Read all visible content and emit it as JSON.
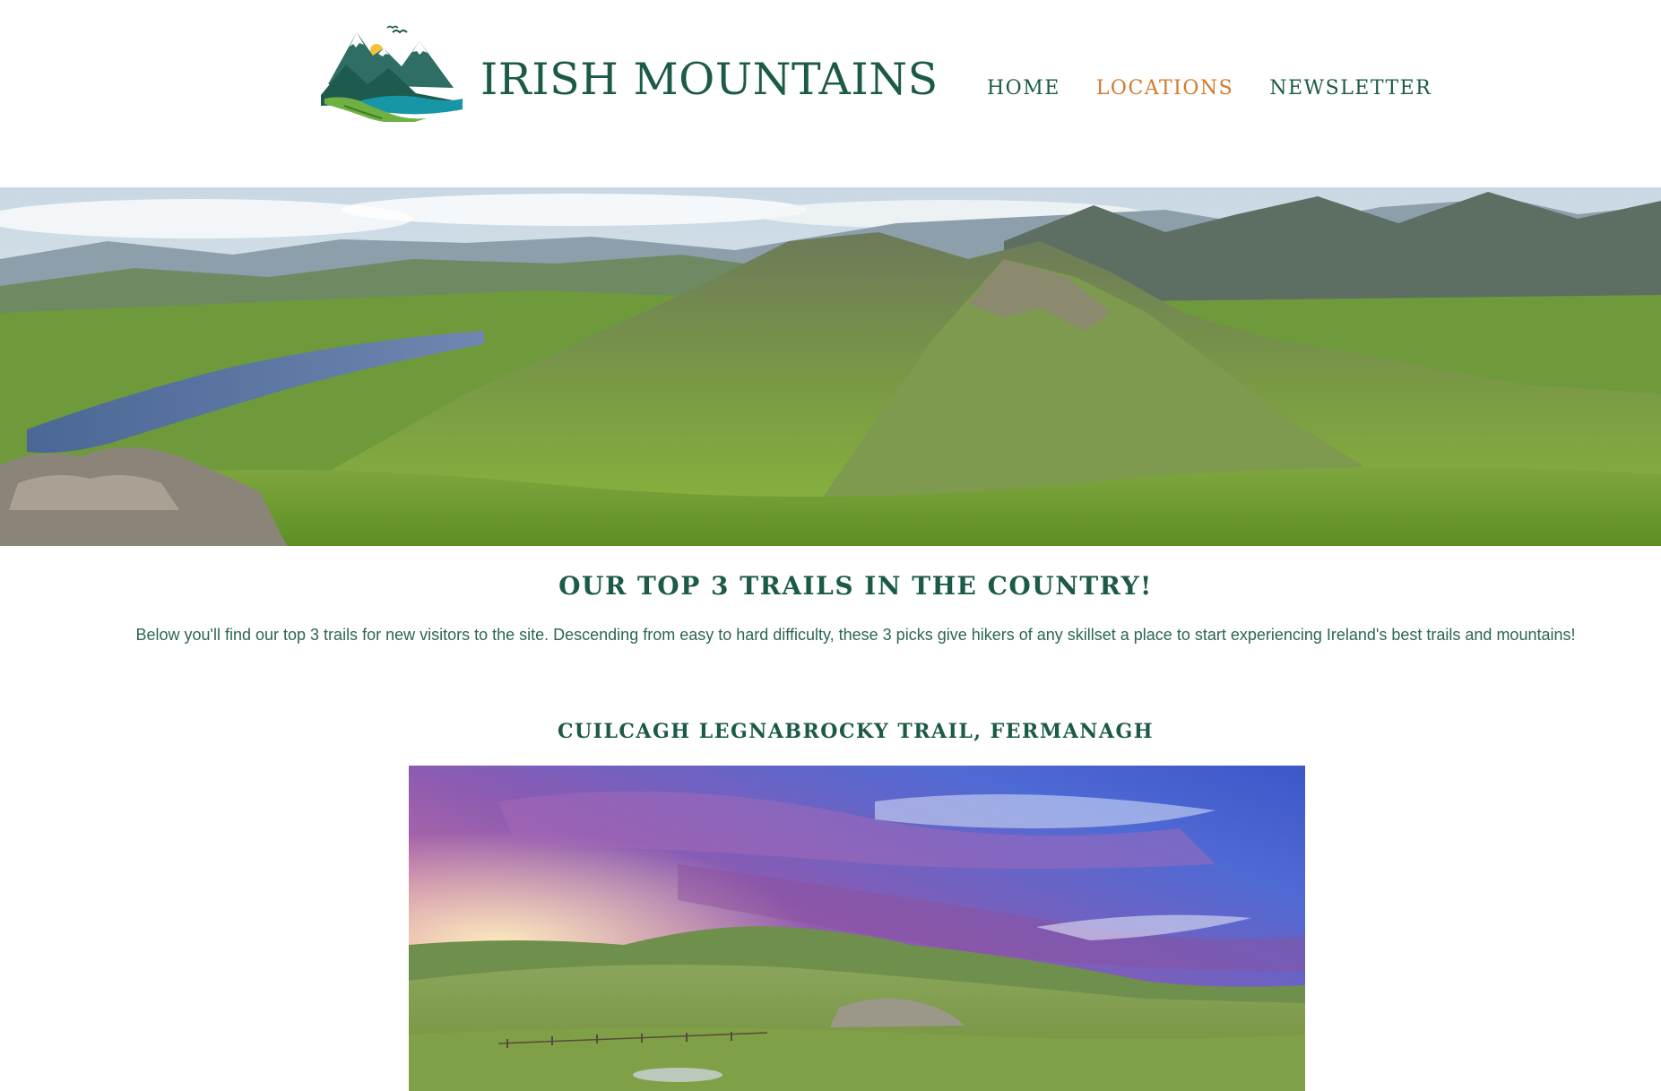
{
  "header": {
    "logo_text": "IRISH MOUNTAINS",
    "nav": [
      {
        "label": "HOME",
        "active": false
      },
      {
        "label": "LOCATIONS",
        "active": true
      },
      {
        "label": "NEWSLETTER",
        "active": false
      }
    ]
  },
  "colors": {
    "primary": "#1b5a48",
    "accent": "#d4782a",
    "body_text": "#2c6555",
    "background": "#ffffff"
  },
  "intro": {
    "heading": "OUR TOP 3 TRAILS IN THE COUNTRY!",
    "text": "Below you'll find our top 3 trails for new visitors to the site. Descending from easy to hard difficulty, these 3 picks give hikers of any skillset a place to start experiencing Ireland's best trails and mountains!"
  },
  "trails": [
    {
      "title": "CUILCAGH LEGNABROCKY TRAIL, FERMANAGH"
    }
  ]
}
